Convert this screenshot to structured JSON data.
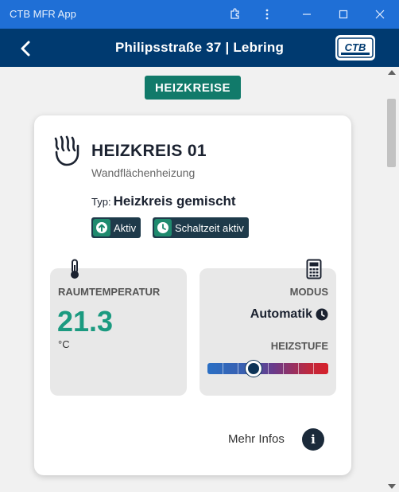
{
  "window": {
    "title": "CTB MFR App"
  },
  "header": {
    "title": "Philipsstraße  37 | Lebring",
    "logo_text": "CTB"
  },
  "section": {
    "badge": "HEIZKREISE"
  },
  "circuit": {
    "name": "HEIZKREIS 01",
    "subtitle": "Wandflächenheizung",
    "type_label": "Typ:",
    "type_value": "Heizkreis gemischt",
    "chips": [
      {
        "label": "Aktiv",
        "icon": "arrow-up-circle-icon"
      },
      {
        "label": "Schaltzeit aktiv",
        "icon": "clock-icon"
      }
    ]
  },
  "temperature": {
    "label": "RAUMTEMPERATUR",
    "value": "21.3",
    "unit": "°C"
  },
  "mode": {
    "label": "MODUS",
    "value": "Automatik",
    "heat_label": "HEIZSTUFE",
    "heat_level_fraction": 0.38
  },
  "footer": {
    "more_label": "Mehr Infos"
  },
  "colors": {
    "titlebar": "#1f6fd6",
    "appbar": "#003a70",
    "accent": "#117a6a",
    "temp": "#1b9a80"
  }
}
